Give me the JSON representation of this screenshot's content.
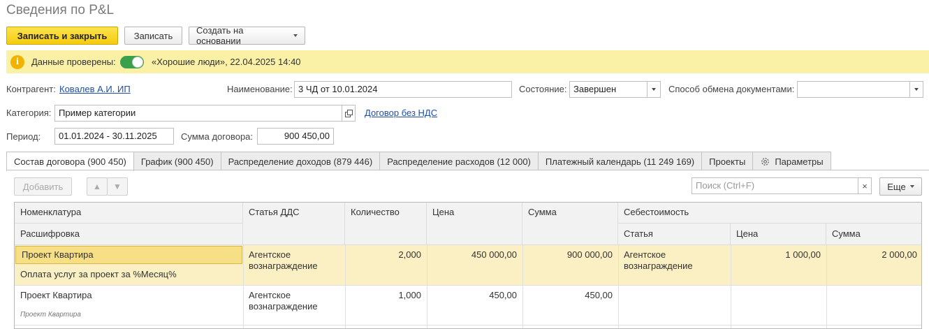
{
  "title": "Сведения по P&L",
  "toolbar": {
    "save_close": "Записать и закрыть",
    "save": "Записать",
    "create_based": "Создать на основании"
  },
  "info": {
    "checked_label": "Данные проверены:",
    "checked_on": true,
    "detail": "«Хорошие люди», 22.04.2025 14:40"
  },
  "form": {
    "counterparty_label": "Контрагент:",
    "counterparty_value": "Ковалев А.И. ИП",
    "name_label": "Наименование:",
    "name_value": "3 ЧД от 10.01.2024",
    "state_label": "Состояние:",
    "state_value": "Завершен",
    "exchange_label": "Способ обмена документами:",
    "exchange_value": "",
    "category_label": "Категория:",
    "category_value": "Пример категории",
    "contract_link": "Договор без НДС",
    "period_label": "Период:",
    "period_value": "01.01.2024 - 30.11.2025",
    "sum_label": "Сумма договора:",
    "sum_value": "900 450,00"
  },
  "tabs": [
    {
      "label": "Состав договора (900 450)"
    },
    {
      "label": "График (900 450)"
    },
    {
      "label": "Распределение доходов (879 446)"
    },
    {
      "label": "Распределение расходов (12 000)"
    },
    {
      "label": "Платежный календарь (11 249 169)"
    },
    {
      "label": "Проекты"
    },
    {
      "label": "Параметры"
    }
  ],
  "table_toolbar": {
    "add": "Добавить",
    "search_placeholder": "Поиск (Ctrl+F)",
    "more": "Еще"
  },
  "table": {
    "headers": {
      "nomenclature": "Номенклатура",
      "decoding": "Расшифровка",
      "dds": "Статья ДДС",
      "qty": "Количество",
      "price": "Цена",
      "sum": "Сумма",
      "cost": "Себестоимость",
      "cost_article": "Статья",
      "cost_price": "Цена",
      "cost_sum": "Сумма"
    },
    "rows": [
      {
        "nomenclature": "Проект Квартира",
        "decoding": "Оплата услуг за проект за %Месяц%",
        "dds_line1": "Агентское",
        "dds_line2": "вознаграждение",
        "qty": "2,000",
        "price": "450 000,00",
        "sum": "900 000,00",
        "cost_article_line1": "Агентское",
        "cost_article_line2": "вознаграждение",
        "cost_price": "1 000,00",
        "cost_sum": "2 000,00"
      },
      {
        "nomenclature": "Проект Квартира",
        "decoding": "Проект Квартира",
        "dds_line1": "Агентское",
        "dds_line2": "вознаграждение",
        "qty": "1,000",
        "price": "450,00",
        "sum": "450,00",
        "cost_article_line1": "",
        "cost_article_line2": "",
        "cost_price": "",
        "cost_sum": ""
      }
    ]
  }
}
